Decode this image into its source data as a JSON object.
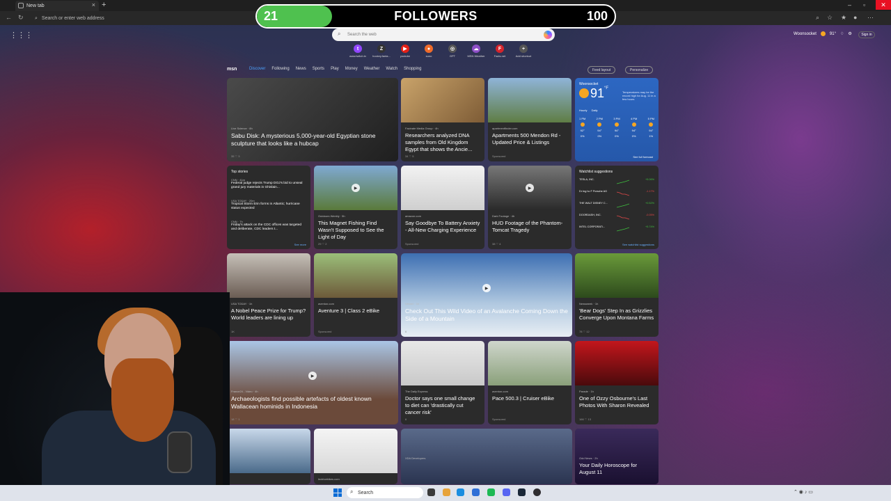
{
  "browser": {
    "tab_title": "New tab",
    "address_placeholder": "Search or enter web address"
  },
  "followers": {
    "current": "21",
    "label": "FOLLOWERS",
    "goal": "100",
    "progress": 0.21,
    "color": "#4fc14f"
  },
  "search": {
    "placeholder": "Search the web"
  },
  "header": {
    "location": "Woonsocket",
    "temp": "91°",
    "signin": "Sign in"
  },
  "shortcuts": [
    {
      "name": "www.twitch.tv",
      "color": "#9146ff",
      "glyph": "t"
    },
    {
      "name": "hockey.fanta...",
      "color": "#333333",
      "glyph": "Z"
    },
    {
      "name": "youtube",
      "color": "#e62117",
      "glyph": "▶"
    },
    {
      "name": "suno",
      "color": "#f06b2a",
      "glyph": "●"
    },
    {
      "name": "GPT",
      "color": "#555555",
      "glyph": "◎"
    },
    {
      "name": "MSN Weather",
      "color": "#8e4fc7",
      "glyph": "☁"
    },
    {
      "name": "Facts.net",
      "color": "#d4242b",
      "glyph": "F"
    },
    {
      "name": "Add shortcut",
      "color": "#555555",
      "glyph": "+"
    }
  ],
  "msn": {
    "logo": "msn",
    "tabs": [
      "Discover",
      "Following",
      "News",
      "Sports",
      "Play",
      "Money",
      "Weather",
      "Watch",
      "Shopping"
    ],
    "feed_layout": "Feed layout",
    "personalize": "Personalize"
  },
  "cards": [
    {
      "source": "Live Science · 8h",
      "title": "Sabu Disk: A mysterious 5,000-year-old Egyptian stone sculpture that looks like a hubcap",
      "meta": "35   ♡   3"
    },
    {
      "source": "Facinate Media Group · 4h",
      "title": "Researchers analyzed DNA samples from Old Kingdom Egypt that shows the Ancie...",
      "meta": "34   ♡   5"
    },
    {
      "source": "apartmentfinder.com",
      "title": "Apartments 500 Mendon Rd - Updated Price & Listings",
      "meta": "Sponsored"
    },
    {
      "source": "Outdoors Weekly · 5h",
      "title": "This Magnet Fishing Find Wasn't Supposed to See the Light of Day",
      "meta": "29   ♡   2"
    },
    {
      "source": "amazon.com",
      "title": "Say Goodbye To Battery Anxiety - All-New Charging Experience",
      "meta": "Sponsored"
    },
    {
      "source": "Dark Footage · 4h",
      "title": "HUD Footage of the Phantom-Tomcat Tragedy",
      "meta": "38   ♡   4"
    },
    {
      "source": "USA TODAY · 1h",
      "title": "A Nobel Peace Prize for Trump? World leaders are lining up",
      "meta": "1K"
    },
    {
      "source": "aventon.com",
      "title": "Aventure 3 | Class 2 eBike",
      "meta": "Sponsored"
    },
    {
      "source": "Viewer · 1h",
      "title": "Check Out This Wild Video of an Avalanche Coming Down the Side of a Mountain",
      "meta": "6"
    },
    {
      "source": "Newsweek · 1h",
      "title": "'Bear Dogs' Step In as Grizzlies Converge Upon Montana Farms",
      "meta": "78   ♡   12"
    },
    {
      "source": "France24 - Video · 4h",
      "title": "Archaeologists find possible artefacts of oldest known Wallacean hominids in Indonesia",
      "meta": "18   ♡   1"
    },
    {
      "source": "The Daily Express",
      "title": "Doctor says one small change to diet can 'drastically cut cancer risk'",
      "meta": "6"
    },
    {
      "source": "aventon.com",
      "title": "Pace 500.3 | Cruiser eBike",
      "meta": "Sponsored"
    },
    {
      "source": "Parade · 1h",
      "title": "One of Ozzy Osbourne's Last Photos With Sharon Revealed",
      "meta": "166   ♡   13"
    },
    {
      "source": "",
      "title": "",
      "meta": ""
    },
    {
      "source": "lectricebikes.com",
      "title": "",
      "meta": ""
    },
    {
      "source": "XDA Developers",
      "title": "",
      "meta": ""
    },
    {
      "source": "Odd News · 2h",
      "title": "Your Daily Horoscope for August 11",
      "meta": ""
    }
  ],
  "weather": {
    "location": "Woonsocket",
    "temp": "91",
    "unit": "°F",
    "description": "Temperatures may be the record high for Aug. 11 in a few hours",
    "tabs": [
      "Hourly",
      "Daily"
    ],
    "hours": [
      {
        "time": "1 PM",
        "temp": "92°",
        "precip": "0%"
      },
      {
        "time": "2 PM",
        "temp": "94°",
        "precip": "0%"
      },
      {
        "time": "3 PM",
        "temp": "94°",
        "precip": "0%"
      },
      {
        "time": "4 PM",
        "temp": "94°",
        "precip": "0%"
      },
      {
        "time": "5 PM",
        "temp": "94°",
        "precip": "1%"
      }
    ],
    "full_forecast": "See full forecast"
  },
  "top_stories": {
    "header": "Top stories",
    "items": [
      {
        "source": "CNN · 41m",
        "text": "Federal judge rejects Trump DOJ's bid to unseal grand jury materials in Ghislain..."
      },
      {
        "source": "USA TODAY · 20m",
        "text": "Tropical Storm Erin forms in Atlantic; hurricane status expected"
      },
      {
        "source": "CNN · 7h",
        "text": "Friday's attack on the CDC offices was targeted and deliberate, CDC leaders t..."
      }
    ],
    "see_more": "See more"
  },
  "watchlist": {
    "header": "Watchlist suggestions",
    "items": [
      {
        "name": "TESLA, INC.",
        "change": "+5.06%",
        "color": "#3fc13f"
      },
      {
        "name": "Dr Ing hc F Porsche AG",
        "change": "-1.17%",
        "color": "#e54848"
      },
      {
        "name": "THE WALT DISNEY C...",
        "change": "+0.52%",
        "color": "#3fc13f"
      },
      {
        "name": "DOORDASH, INC.",
        "change": "-0.05%",
        "color": "#e54848"
      },
      {
        "name": "INTEL CORPORATI...",
        "change": "+5.74%",
        "color": "#3fc13f"
      }
    ],
    "see_more": "See watchlist suggestions"
  },
  "taskbar": {
    "search": "Search"
  }
}
